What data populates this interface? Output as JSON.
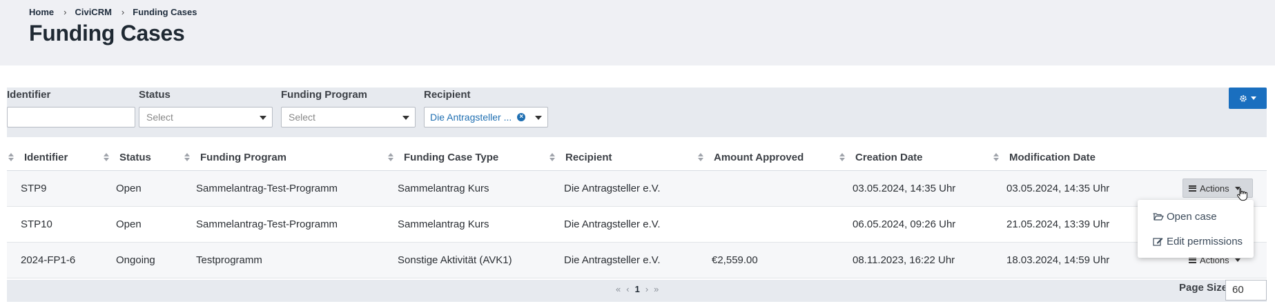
{
  "breadcrumb": {
    "items": [
      "Home",
      "CiviCRM",
      "Funding Cases"
    ],
    "separator": "›"
  },
  "page": {
    "title": "Funding Cases"
  },
  "filters": {
    "identifier": {
      "label": "Identifier",
      "value": ""
    },
    "status": {
      "label": "Status",
      "placeholder": "Select"
    },
    "funding_program": {
      "label": "Funding Program",
      "placeholder": "Select"
    },
    "recipient": {
      "label": "Recipient",
      "value": "Die Antragsteller ..."
    }
  },
  "table": {
    "columns": [
      "Identifier",
      "Status",
      "Funding Program",
      "Funding Case Type",
      "Recipient",
      "Amount Approved",
      "Creation Date",
      "Modification Date"
    ],
    "rows": [
      {
        "identifier": "STP9",
        "status": "Open",
        "program": "Sammelantrag-Test-Programm",
        "type": "Sammelantrag Kurs",
        "recipient": "Die Antragsteller e.V.",
        "amount": "",
        "created": "03.05.2024, 14:35 Uhr",
        "modified": "03.05.2024, 14:35 Uhr"
      },
      {
        "identifier": "STP10",
        "status": "Open",
        "program": "Sammelantrag-Test-Programm",
        "type": "Sammelantrag Kurs",
        "recipient": "Die Antragsteller e.V.",
        "amount": "",
        "created": "06.05.2024, 09:26 Uhr",
        "modified": "21.05.2024, 13:39 Uhr"
      },
      {
        "identifier": "2024-FP1-6",
        "status": "Ongoing",
        "program": "Testprogramm",
        "type": "Sonstige Aktivität (AVK1)",
        "recipient": "Die Antragsteller e.V.",
        "amount": "€2,559.00",
        "created": "08.11.2023, 16:22 Uhr",
        "modified": "18.03.2024, 14:59 Uhr"
      }
    ],
    "actions_label": "Actions"
  },
  "dropdown": {
    "items": [
      "Open case",
      "Edit permissions"
    ]
  },
  "pagination": {
    "first": "«",
    "prev": "‹",
    "current": "1",
    "next": "›",
    "last": "»"
  },
  "page_size": {
    "label": "Page Size",
    "value": "60"
  },
  "colors": {
    "primary": "#1a6fbf",
    "header_bg": "#eff0f4",
    "filter_bg": "#e7eaef"
  }
}
